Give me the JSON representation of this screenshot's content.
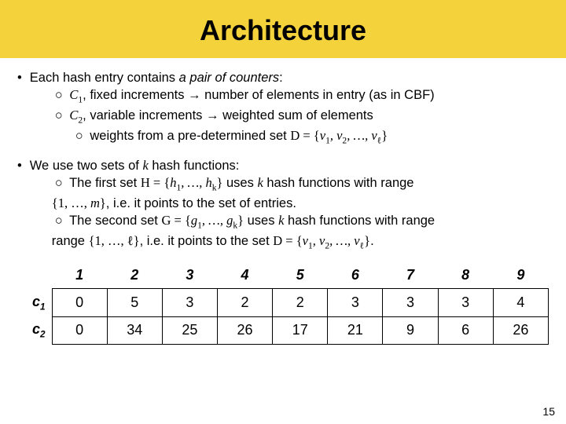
{
  "title": "Architecture",
  "bullets": {
    "b1": "Each hash entry contains",
    "b1_ital": "a pair of counters",
    "b1_tail": ":",
    "c1sym": "C",
    "c1idx": "1",
    "c1desc": ", fixed increments → number of elements in entry (as in CBF)",
    "c2sym": "C",
    "c2idx": "2",
    "c2desc": ", variable increments → weighted sum of elements",
    "wdesc": "weights from a pre-determined set ",
    "dset": "D = {v₁, v₂, …, v",
    "dsub": "ℓ",
    "dend": "}",
    "b2a": "We use two sets of ",
    "kvar": "k",
    "b2b": " hash functions:",
    "first1": "The first set ",
    "Hset": "H = {h₁, …, h",
    "Hsub": "k",
    "Hend": "}",
    "first2": " uses ",
    "first3": " hash functions with range",
    "range1": "{1, …, m}",
    "first4": ", i.e. it points to the set of entries.",
    "sec1": "The second set ",
    "Gset": "G = {g₁, …, g",
    "Gsub": "k",
    "Gend": "}",
    "sec2": " uses ",
    "sec3": " hash functions with range ",
    "range2": "{1, …, ℓ}",
    "sec4": ", i.e. it points to the set ",
    "Dset2": "D = {v₁, v₂, …, v",
    "Dsub2": "ℓ",
    "Dend2": "}",
    "period": "."
  },
  "chart_data": {
    "type": "table",
    "columns": [
      "1",
      "2",
      "3",
      "4",
      "5",
      "6",
      "7",
      "8",
      "9"
    ],
    "rows": [
      {
        "name": "C1",
        "label": "c",
        "sub": "1",
        "values": [
          "0",
          "5",
          "3",
          "2",
          "2",
          "3",
          "3",
          "3",
          "4"
        ]
      },
      {
        "name": "C2",
        "label": "c",
        "sub": "2",
        "values": [
          "0",
          "34",
          "25",
          "26",
          "17",
          "21",
          "9",
          "6",
          "26"
        ]
      }
    ]
  },
  "pagenum": "15"
}
